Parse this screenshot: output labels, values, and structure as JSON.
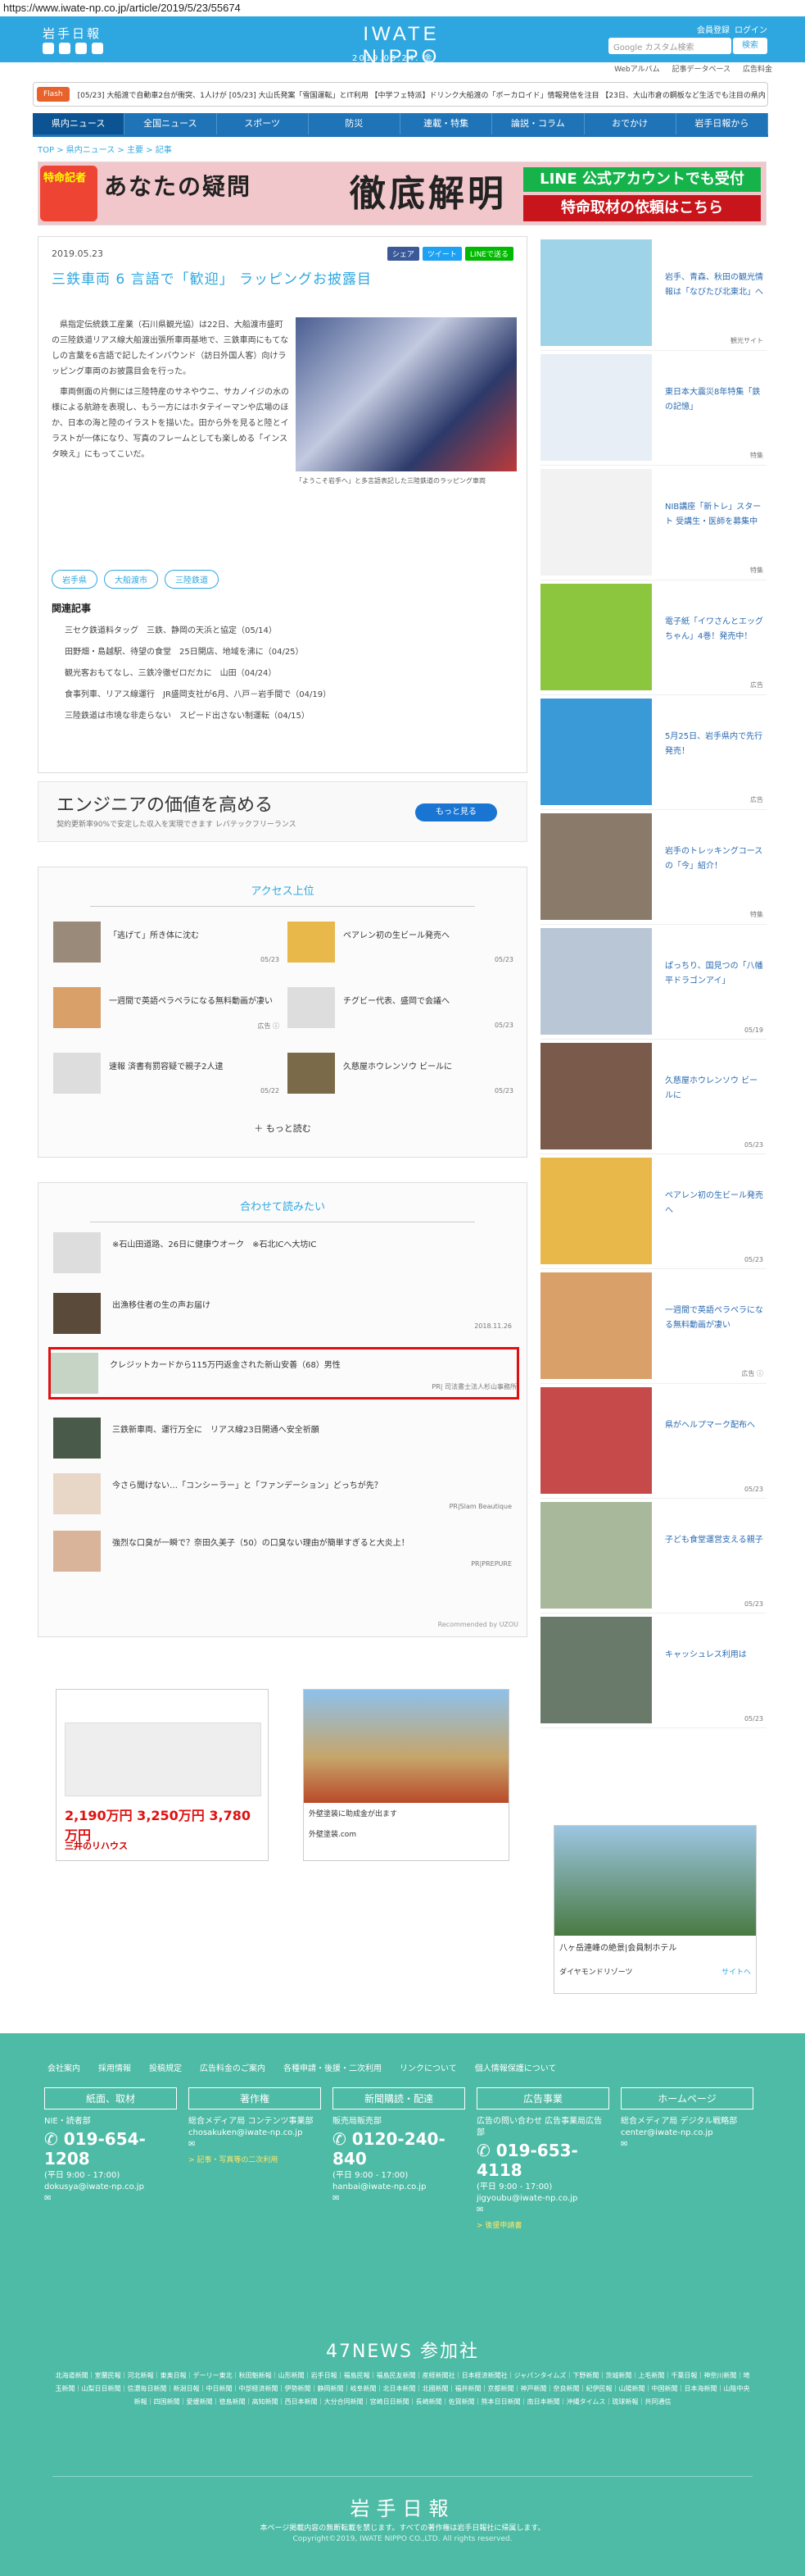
{
  "url": "https://www.iwate-np.co.jp/article/2019/5/23/55674",
  "header": {
    "logo": "岩手日報",
    "brand": "IWATE NIPPO",
    "date": "2019.05.24. 金",
    "links": [
      "会員登録",
      "ログイン"
    ],
    "search_placeholder": "Google カスタム検索",
    "search_button": "検索"
  },
  "subnav": [
    "Webアルバム",
    "記事データベース",
    "広告料金"
  ],
  "flash": {
    "tag": "Flash",
    "text": "[05/23] 大船渡で自動車2台が衝突、1人けが [05/23] 大山氏発案「雪国運転」とIT利用 【中学フェ特派】ドリンク大船渡の「ボーカロイド」情報発信を注目 【23日、大山市倉の鋼板など生活でも注目の県内経済が3」"
  },
  "gnav": [
    "県内ニュース",
    "全国ニュース",
    "スポーツ",
    "防災",
    "連載・特集",
    "論説・コラム",
    "おでかけ",
    "岩手日報から"
  ],
  "breadcrumb": "TOP > 県内ニュース > 主要 > 記事",
  "banner": {
    "left": "特命記者",
    "mid": "あなたの疑問",
    "main": "徹底解明",
    "line": "LINE 公式アカウントでも受付",
    "req": "特命取材の依頼はこちら"
  },
  "article": {
    "date": "2019.05.23",
    "share": [
      "シェア",
      "ツイート",
      "LINEで送る"
    ],
    "title": "三鉄車両 6 言語で「歓迎」 ラッピングお披露目",
    "body": [
      "県指定伝統鉄工産業（石川県観光協）は22日、大船渡市盛町の三陸鉄道リアス線大船渡出張所車両基地で、三鉄車両にもてなしの言葉を6言語で記したインバウンド（訪日外国人客）向けラッピング車両のお披露目会を行った。",
      "車両側面の片側には三陸特産のサネやウニ、サカノイジの水の様による航跡を表現し、もう一方にはホタテイーマンや広場のほか、日本の海と陸のイラストを描いた。田から外を見ると陸とイラストが一体になり、写真のフレームとしても楽しめる「インスタ映え」にもってこいだ。"
    ],
    "caption": "「ようこそ岩手へ」と多言語表記した三陸鉄道のラッピング車両",
    "tags": [
      "岩手県",
      "大船渡市",
      "三陸鉄道"
    ],
    "related_heading": "関連記事",
    "related": [
      "三セク鉄道料タッグ　三鉄、静岡の天浜と協定（05/14）",
      "田野畑・島越駅、待望の食堂　25日開店、地域を沸に（04/25）",
      "観光客おもてなし、三鉄冷徹ゼロだカに　山田（04/24）",
      "食事列車、リアス線運行　JR盛岡支社が6月、八戸－岩手間で（04/19）",
      "三陸鉄道は市境な非走らない　スピード出さない制運転（04/15）"
    ]
  },
  "ad1": {
    "title": "エンジニアの価値を高める",
    "sub": "契約更新率90%で安定した収入を実現できます レバテックフリーランス",
    "button": "もっと見る"
  },
  "ranking": {
    "heading": "アクセス上位",
    "items": [
      {
        "text": "「逃げて」所き体に沈む",
        "date": "05/23"
      },
      {
        "text": "ペアレン初の生ビール発売へ",
        "date": "05/23"
      },
      {
        "text": "一週間で英語ペラペラになる無料動画が凄い",
        "date": "広告 ⓘ"
      },
      {
        "text": "チグビー代表、盛岡で会議へ",
        "date": "05/23"
      },
      {
        "text": "速報 済書有罰容疑で親子2人逮",
        "date": "05/22"
      },
      {
        "text": "久慈屋ホウレンソウ ビールに",
        "date": "05/23"
      }
    ],
    "more": "もっと読む"
  },
  "recommend": {
    "heading": "合わせて読みたい",
    "items": [
      {
        "text": "※石山田道路、26日に健康ウオーク　※石北ICへ大坊IC",
        "sub": ""
      },
      {
        "text": "出漁移住者の生の声お届け",
        "sub": "2018.11.26"
      },
      {
        "text": "クレジットカードから115万円返金された新山安善（68）男性",
        "sub": "PR| 司法書士法人杉山事務所"
      },
      {
        "text": "三鉄新車両、運行万全に　リアス線23日開通へ安全祈願",
        "sub": ""
      },
      {
        "text": "今さら聞けない…「コンシーラー」と「ファンデーション」どっちが先？",
        "sub": "PR|Slam Beautique"
      },
      {
        "text": "強烈な口臭が一瞬で？奈田久美子（50）の口臭ない理由が簡単すぎると大炎上！",
        "sub": "PR|PREPURE"
      }
    ],
    "powered": "Recommended by UZOU"
  },
  "ad2": {
    "price": "2,190万円 3,250万円 3,780万円",
    "logo": "三井のリハウス"
  },
  "ad3": {
    "text": "外壁塗装に助成金が出ます",
    "site": "外壁塗装.com"
  },
  "side": [
    {
      "text": "岩手、青森、秋田の観光情報は「なびたび北東北」へ",
      "sub": "観光サイト"
    },
    {
      "text": "東日本大震災8年特集「鉄の記憶」",
      "sub": "特集"
    },
    {
      "text": "NIB講座「新トレ」スタート 受講生・医師を募集中",
      "sub": "特集"
    },
    {
      "text": "電子紙「イワさんとエッグちゃん」4巻！発売中！",
      "sub": "広告"
    },
    {
      "text": "5月25日、岩手県内で先行発売！",
      "sub": "広告"
    },
    {
      "text": "岩手のトレッキングコースの「今」紹介！",
      "sub": "特集"
    },
    {
      "text": "ぱっちり、国見つの「八幡平ドラゴンアイ」",
      "sub": "05/19"
    },
    {
      "text": "久慈屋ホウレンソウ ビールに",
      "sub": "05/23"
    },
    {
      "text": "ペアレン初の生ビール発売へ",
      "sub": "05/23"
    },
    {
      "text": "一週間で英語ペラペラになる無料動画が凄い",
      "sub": "広告 ⓘ"
    },
    {
      "text": "県がヘルプマーク配布へ",
      "sub": "05/23"
    },
    {
      "text": "子ども食堂運営支える親子",
      "sub": "05/23"
    },
    {
      "text": "キャッシュレス利用は",
      "sub": "05/23"
    }
  ],
  "side_ad": {
    "title": "八ヶ岳連峰の絶景|会員制ホテル",
    "foot": "ダイヤモンドリゾーツ",
    "site": "サイトへ"
  },
  "footer": {
    "links": [
      "会社案内",
      "採用情報",
      "投稿規定",
      "広告料金のご案内",
      "各種申請・後援・二次利用",
      "リンクについて",
      "個人情報保護について"
    ],
    "cols": [
      {
        "h": "紙面、取材",
        "s": "NIE・読者部",
        "tel": "019-654-1208",
        "hours": "(平日 9:00 - 17:00)",
        "mail": "dokusya@iwate-np.co.jp",
        "y": ""
      },
      {
        "h": "著作権",
        "s": "総合メディア局 コンテンツ事業部",
        "tel": "",
        "hours": "",
        "mail": "chosakuken@iwate-np.co.jp",
        "y": "> 記事・写真等の二次利用"
      },
      {
        "h": "新聞購読・配達",
        "s": "販売局販売部",
        "tel": "0120-240-840",
        "hours": "(平日 9:00 - 17:00)",
        "mail": "hanbai@iwate-np.co.jp",
        "y": ""
      },
      {
        "h": "広告事業",
        "s": "広告の問い合わせ 広告事業局広告部",
        "tel": "019-653-4118",
        "hours": "(平日 9:00 - 17:00)",
        "mail": "jigyoubu@iwate-np.co.jp",
        "y": "> 後援申請書"
      },
      {
        "h": "ホームページ",
        "s": "総合メディア局 デジタル戦略部",
        "tel": "",
        "hours": "",
        "mail": "center@iwate-np.co.jp",
        "y": ""
      }
    ],
    "news47": "47NEWS 参加社",
    "papers": "北海道新聞｜室蘭民報｜河北新報｜東奥日報｜デーリー東北｜秋田魁新報｜山形新聞｜岩手日報｜福島民報｜福島民友新聞｜産経新聞社｜日本経済新聞社｜ジャパンタイムズ｜下野新聞｜茨城新聞｜上毛新聞｜千葉日報｜神奈川新聞｜埼玉新聞｜山梨日日新聞｜信濃毎日新聞｜新潟日報｜中日新聞｜中部経済新聞｜伊勢新聞｜静岡新聞｜岐阜新聞｜北日本新聞｜北國新聞｜福井新聞｜京都新聞｜神戸新聞｜奈良新聞｜紀伊民報｜山陽新聞｜中国新聞｜日本海新聞｜山陰中央新報｜四国新聞｜愛媛新聞｜徳島新聞｜高知新聞｜西日本新聞｜大分合同新聞｜宮崎日日新聞｜長崎新聞｜佐賀新聞｜熊本日日新聞｜南日本新聞｜沖縄タイムス｜琉球新報｜共同通信",
    "logo": "岩手日報",
    "note": "本ページ掲載内容の無断転載を禁じます。すべての著作権は岩手日報社に帰属します。",
    "copy": "Copyright©2019, IWATE NIPPO CO.,LTD. All rights reserved."
  },
  "colors": {
    "accent": "#2ea7e0",
    "nav": "#1f73b7",
    "footer": "#4dbba5",
    "highlight": "#e01010"
  }
}
